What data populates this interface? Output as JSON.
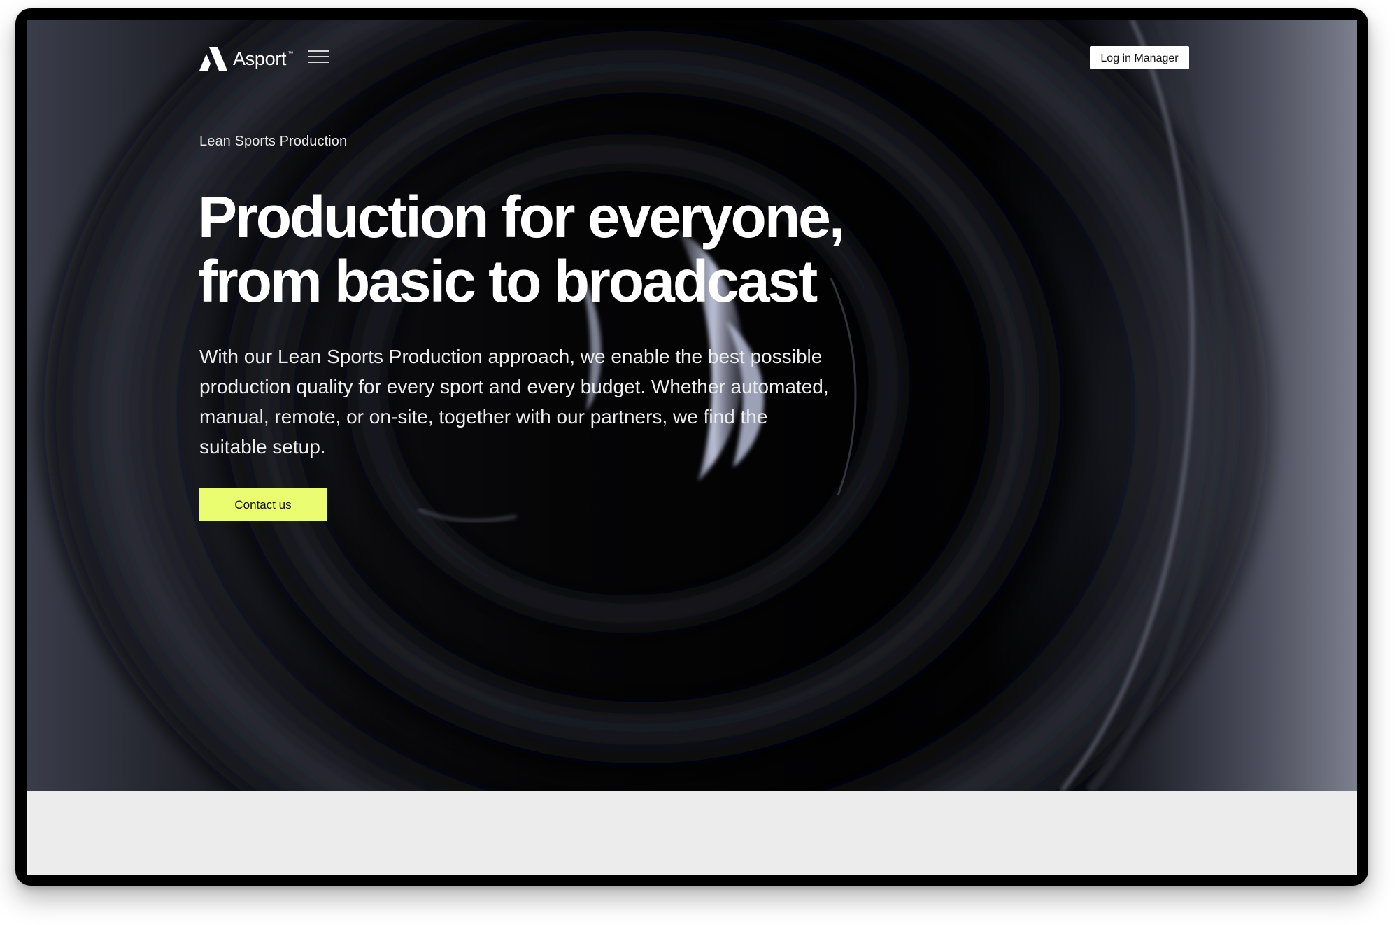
{
  "header": {
    "brand_name": "Asport",
    "brand_tm": "™",
    "logo_icon": "asport-logo-icon",
    "menu_icon": "hamburger-menu-icon",
    "login_label": "Log in Manager"
  },
  "hero": {
    "eyebrow": "Lean Sports Production",
    "headline_line1": "Production for everyone,",
    "headline_line2": "from basic to broadcast",
    "body": "With our Lean Sports Production approach, we enable the best possible production quality for every sport and every budget. Whether automated, manual, remote, or on-site, together with our partners, we find the suitable setup.",
    "cta_label": "Contact us",
    "background_image": "camera-lens-closeup"
  },
  "colors": {
    "cta_background": "#eafd71",
    "hero_background": "#050507",
    "below_fold_background": "#ececec",
    "text_primary": "#ffffff"
  }
}
